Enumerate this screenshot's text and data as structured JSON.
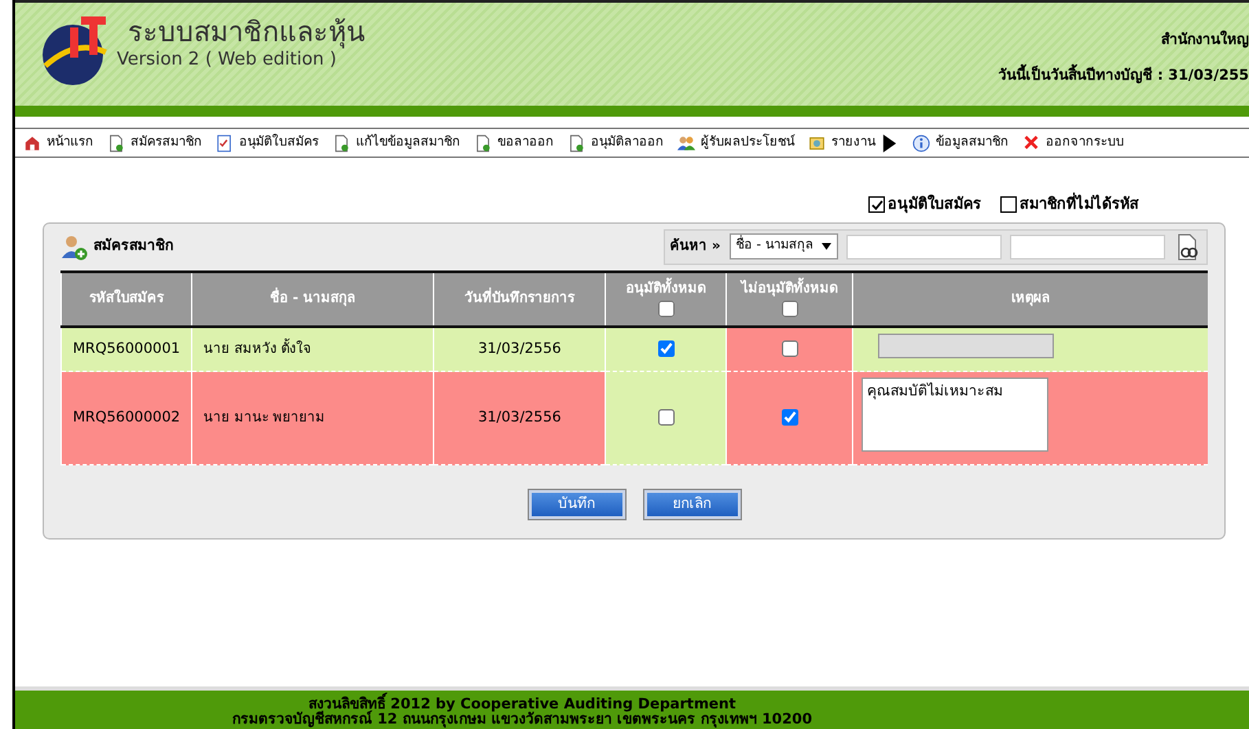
{
  "header": {
    "title": "ระบบสมาชิกและหุ้น",
    "subtitle": "Version 2 ( Web edition )",
    "office": "สำนักงานใหญ",
    "date_text": "วันนี้เป็นวันสิ้นปีทางบัญชี : 31/03/255"
  },
  "menu": [
    {
      "label": "หน้าแรก",
      "kind": "home"
    },
    {
      "label": "สมัครสมาชิก",
      "kind": "doc"
    },
    {
      "label": "อนุมัติใบสมัคร",
      "kind": "check"
    },
    {
      "label": "แก้ไขข้อมูลสมาชิก",
      "kind": "doc"
    },
    {
      "label": "ขอลาออก",
      "kind": "doc"
    },
    {
      "label": "อนุมัติลาออก",
      "kind": "doc"
    },
    {
      "label": "ผู้รับผลประโยชน์",
      "kind": "people"
    },
    {
      "label": "รายงาน",
      "kind": "report",
      "submenu": true
    },
    {
      "label": "ข้อมูลสมาชิก",
      "kind": "info"
    },
    {
      "label": "ออกจากระบบ",
      "kind": "exit"
    }
  ],
  "filters": [
    {
      "label": "อนุมัติใบสมัคร",
      "checked": true
    },
    {
      "label": "สมาชิกที่ไม่ได้รหัส",
      "checked": false
    }
  ],
  "panel": {
    "title": "สมัครสมาชิก",
    "search_label": "ค้นหา »",
    "search_select": "ชื่อ - นามสกุล",
    "table": {
      "columns": [
        "รหัสใบสมัคร",
        "ชื่อ - นามสกุล",
        "วันที่บันทึกรายการ",
        "อนุมัติทั้งหมด",
        "ไม่อนุมัติทั้งหมด",
        "เหตุผล"
      ],
      "approve_all": false,
      "reject_all": false,
      "rows": [
        {
          "code": "MRQ56000001",
          "name": "นาย สมหวัง ตั้งใจ",
          "date": "31/03/2556",
          "approved": true,
          "rejected": false
        },
        {
          "code": "MRQ56000002",
          "name": "นาย มานะ พยายาม",
          "date": "31/03/2556",
          "approved": false,
          "rejected": true,
          "reason": "คุณสมบัติไม่เหมาะสม"
        }
      ]
    },
    "buttons": [
      "บันทึก",
      "ยกเลิก"
    ]
  },
  "footer": [
    "สงวนลิขสิทธิ์ 2012 by Cooperative Auditing Department",
    "กรมตรวจบัญชีสหกรณ์ 12 ถนนกรุงเกษม แขวงวัดสามพระยา เขตพระนคร กรุงเทพฯ 10200"
  ]
}
